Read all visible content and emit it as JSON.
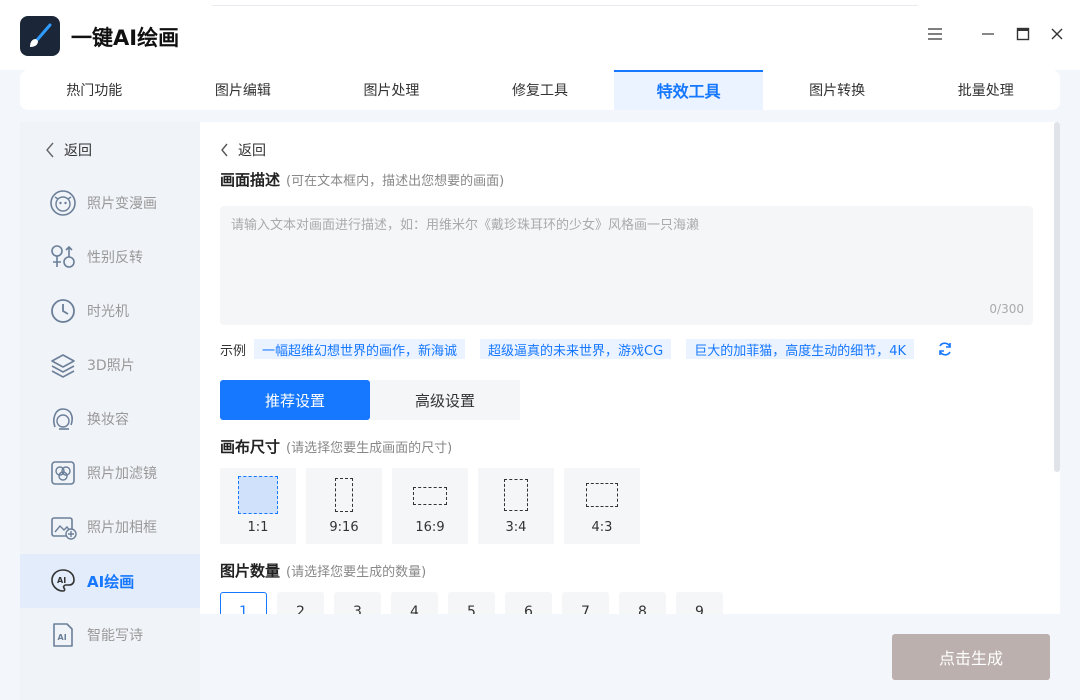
{
  "app": {
    "title": "一键AI绘画"
  },
  "tabs": [
    {
      "label": "热门功能"
    },
    {
      "label": "图片编辑"
    },
    {
      "label": "图片处理"
    },
    {
      "label": "修复工具"
    },
    {
      "label": "特效工具",
      "active": true
    },
    {
      "label": "图片转换"
    },
    {
      "label": "批量处理"
    }
  ],
  "sidebar": {
    "back_label": "返回",
    "items": [
      {
        "label": "照片变漫画",
        "icon": "cartoon-face-icon"
      },
      {
        "label": "性别反转",
        "icon": "gender-swap-icon"
      },
      {
        "label": "时光机",
        "icon": "clock-icon"
      },
      {
        "label": "3D照片",
        "icon": "layers-icon"
      },
      {
        "label": "换妆容",
        "icon": "makeup-face-icon"
      },
      {
        "label": "照片加滤镜",
        "icon": "filter-icon"
      },
      {
        "label": "照片加相框",
        "icon": "frame-icon"
      },
      {
        "label": "AI绘画",
        "icon": "ai-paint-icon",
        "active": true
      },
      {
        "label": "智能写诗",
        "icon": "ai-poem-icon"
      }
    ]
  },
  "main": {
    "back_label": "返回",
    "description": {
      "title": "画面描述",
      "hint": "(可在文本框内，描述出您想要的画面)",
      "placeholder": "请输入文本对画面进行描述，如：用维米尔《戴珍珠耳环的少女》风格画一只海濑",
      "counter": "0/300"
    },
    "examples": {
      "label": "示例",
      "items": [
        "一幅超维幻想世界的画作，新海诚",
        "超级逼真的未来世界，游戏CG",
        "巨大的加菲猫，高度生动的细节，4K"
      ]
    },
    "modes": [
      {
        "label": "推荐设置",
        "active": true
      },
      {
        "label": "高级设置"
      }
    ],
    "canvas_size": {
      "title": "画布尺寸",
      "hint": "(请选择您要生成画面的尺寸)",
      "options": [
        "1:1",
        "9:16",
        "16:9",
        "3:4",
        "4:3"
      ],
      "selected": "1:1"
    },
    "image_count": {
      "title": "图片数量",
      "hint": "(请选择您要生成的数量)",
      "options": [
        "1",
        "2",
        "3",
        "4",
        "5",
        "6",
        "7",
        "8",
        "9"
      ],
      "selected": "1"
    }
  },
  "generate_label": "点击生成",
  "colors": {
    "accent": "#1677ff",
    "generate_bg": "#bcb0ae",
    "app_icon_bg": "#1b2738"
  }
}
